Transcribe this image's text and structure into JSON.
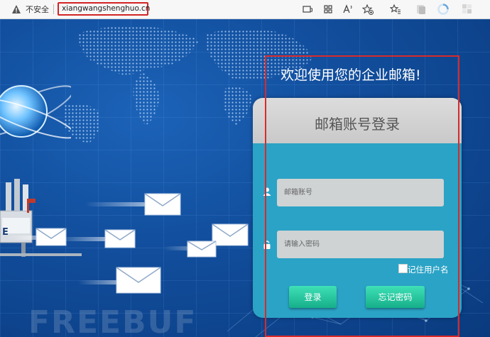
{
  "browser": {
    "security_label": "不安全",
    "url": "xiangwangshenghuo.cn",
    "toolbar_icons": [
      "reader-mode-icon",
      "app-grid-icon",
      "read-aloud-icon",
      "favorite-add-icon",
      "favorites-icon",
      "collections-icon",
      "sync-icon",
      "profile-icon"
    ]
  },
  "page": {
    "headline": "欢迎使用您的企业邮箱!",
    "watermark": "FREEBUF"
  },
  "login": {
    "title": "邮箱账号登录",
    "username_placeholder": "邮箱账号",
    "password_placeholder": "请输入密码",
    "remember_label": "记住用户名",
    "login_button": "登录",
    "forgot_button": "忘记密码"
  },
  "colors": {
    "background": "#0d3f8a",
    "card": "#2ba3c6",
    "button": "#1fc59c",
    "highlight": "#d92a2a"
  }
}
